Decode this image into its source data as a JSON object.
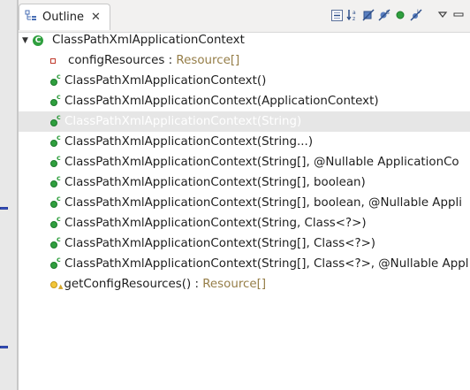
{
  "view": {
    "tab_label": "Outline",
    "close_glyph": "✕",
    "toolbar": [
      {
        "name": "collapse-all-icon"
      },
      {
        "name": "sort-az-icon"
      },
      {
        "name": "hide-fields-icon"
      },
      {
        "name": "hide-static-icon"
      },
      {
        "name": "hide-non-public-icon"
      },
      {
        "name": "hide-local-types-icon"
      },
      {
        "name": "link-with-editor-icon"
      },
      {
        "name": "view-menu-icon"
      },
      {
        "name": "minimize-icon"
      }
    ]
  },
  "tree": {
    "root": "ClassPathXmlApplicationContext",
    "field": {
      "name": "configResources",
      "sep": " : ",
      "type": "Resource[]"
    },
    "constructors": [
      "ClassPathXmlApplicationContext()",
      "ClassPathXmlApplicationContext(ApplicationContext)",
      "ClassPathXmlApplicationContext(String)",
      "ClassPathXmlApplicationContext(String...)",
      "ClassPathXmlApplicationContext(String[], @Nullable ApplicationCo",
      "ClassPathXmlApplicationContext(String[], boolean)",
      "ClassPathXmlApplicationContext(String[], boolean, @Nullable Appli",
      "ClassPathXmlApplicationContext(String, Class<?>)",
      "ClassPathXmlApplicationContext(String[], Class<?>)",
      "ClassPathXmlApplicationContext(String[], Class<?>, @Nullable Appl"
    ],
    "method": {
      "name": "getConfigResources()",
      "sep": " : ",
      "type": "Resource[]"
    }
  },
  "colors": {
    "accent": "#2f9f3e",
    "type_text": "#957d47",
    "selection": "#e6e6e6"
  }
}
